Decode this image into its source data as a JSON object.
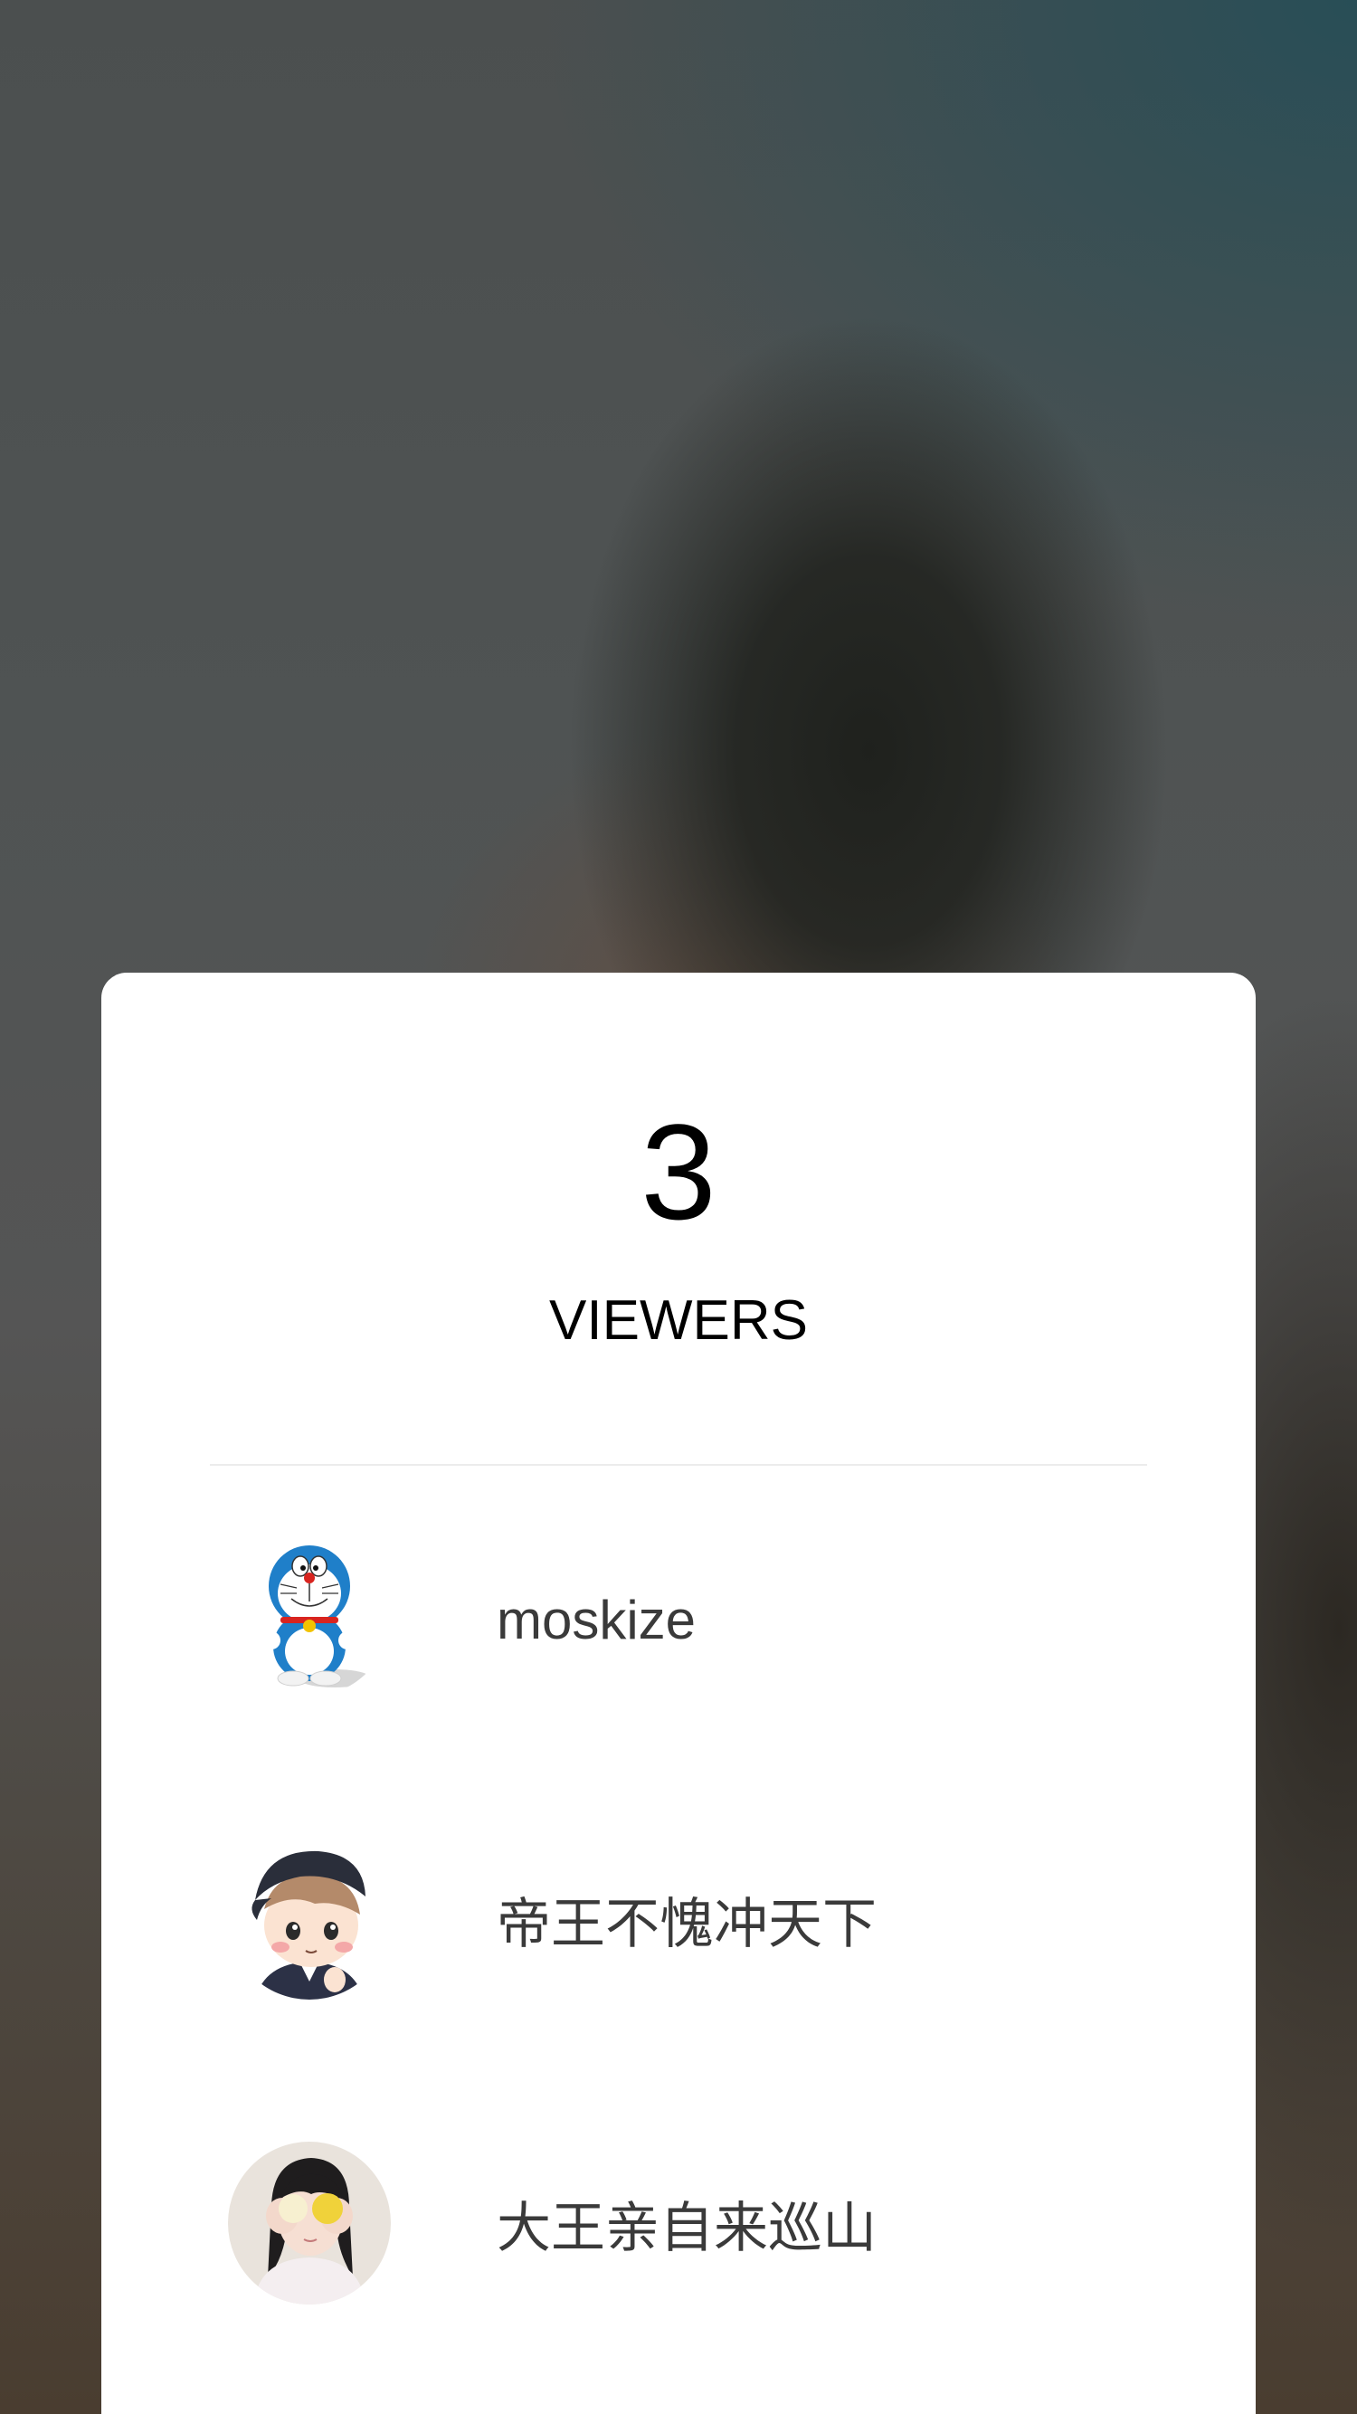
{
  "viewers_panel": {
    "count": "3",
    "label": "VIEWERS",
    "viewers": [
      {
        "name": "moskize",
        "avatar": "doraemon-avatar"
      },
      {
        "name": "帝王不愧冲天下",
        "avatar": "cartoon-boy-cap-avatar"
      },
      {
        "name": "大王亲自来巡山",
        "avatar": "girl-lemon-photo-avatar"
      }
    ]
  },
  "colors": {
    "sheet_background": "#ffffff",
    "name_text": "#3a3a3a",
    "divider": "#ececec"
  }
}
